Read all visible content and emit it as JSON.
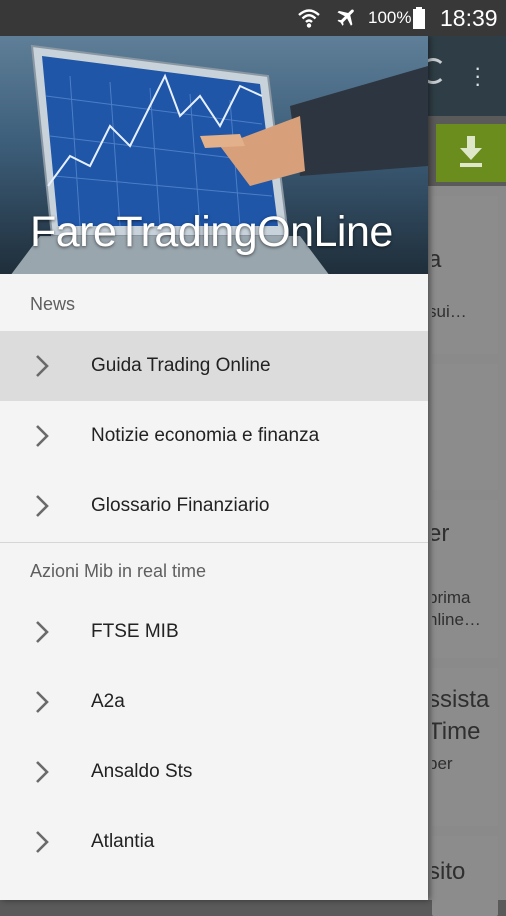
{
  "status_bar": {
    "battery_percent": "100%",
    "time": "18:39"
  },
  "drawer": {
    "header_title": "FareTradingOnLine",
    "sections": [
      {
        "label": "News",
        "items": [
          {
            "label": "Guida Trading Online",
            "selected": true
          },
          {
            "label": "Notizie economia e finanza",
            "selected": false
          },
          {
            "label": "Glossario Finanziario",
            "selected": false
          }
        ]
      },
      {
        "label": "Azioni Mib in real time",
        "items": [
          {
            "label": "FTSE MIB",
            "selected": false
          },
          {
            "label": "A2a",
            "selected": false
          },
          {
            "label": "Ansaldo Sts",
            "selected": false
          },
          {
            "label": "Atlantia",
            "selected": false
          }
        ]
      }
    ]
  },
  "background_app": {
    "card_fragments": [
      "a",
      "sui…",
      "er",
      "prima",
      "nline…",
      "ssista",
      "Time",
      "per",
      "sito"
    ]
  },
  "icons": {
    "status": [
      "wifi-icon",
      "airplane-icon",
      "battery-icon"
    ],
    "nav": "chevron-right-icon",
    "toolbar": [
      "refresh-icon",
      "overflow-menu-icon",
      "download-icon"
    ]
  }
}
